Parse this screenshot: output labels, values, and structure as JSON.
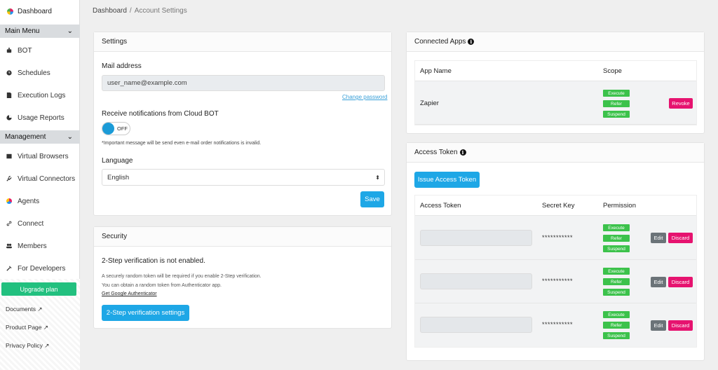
{
  "sidebar": {
    "dashboard": "Dashboard",
    "sections": [
      {
        "label": "Main Menu",
        "items": [
          "BOT",
          "Schedules",
          "Execution Logs",
          "Usage Reports"
        ]
      },
      {
        "label": "Management",
        "items": [
          "Virtual Browsers",
          "Virtual Connectors",
          "Agents",
          "Connect",
          "Members",
          "For Developers"
        ]
      }
    ],
    "upgrade": "Upgrade plan",
    "links": [
      "Documents",
      "Product Page",
      "Privacy Policy"
    ]
  },
  "breadcrumb": {
    "root": "Dashboard",
    "separator": "/",
    "current": "Account Settings"
  },
  "settings": {
    "title": "Settings",
    "mail_label": "Mail address",
    "mail_value": "user_name@example.com",
    "change_password": "Change password",
    "notify_label": "Receive notifications from Cloud BOT",
    "toggle_state": "OFF",
    "important_note": "*Important message will be send even e-mail order notifications is invalid.",
    "language_label": "Language",
    "language_value": "English",
    "save": "Save"
  },
  "security": {
    "title": "Security",
    "status": "2-Step verification is not enabled.",
    "desc1": "A securely random token will be required if you enable 2-Step verification.",
    "desc2": "You can obtain a random token from Authenticator app.",
    "ga_link": "Get Google Authenticator",
    "button": "2-Step verification settings"
  },
  "connected_apps": {
    "title": "Connected Apps",
    "headers": [
      "App Name",
      "Scope"
    ],
    "rows": [
      {
        "name": "Zapier",
        "scopes": [
          "Execute",
          "Refer",
          "Suspend"
        ],
        "action": "Revoke"
      }
    ]
  },
  "access_token": {
    "title": "Access Token",
    "issue_button": "Issue Access Token",
    "headers": [
      "Access Token",
      "Secret Key",
      "Permission"
    ],
    "rows": [
      {
        "secret": "***********",
        "scopes": [
          "Execute",
          "Refer",
          "Suspend"
        ],
        "edit": "Edit",
        "discard": "Discard"
      },
      {
        "secret": "***********",
        "scopes": [
          "Execute",
          "Refer",
          "Suspend"
        ],
        "edit": "Edit",
        "discard": "Discard"
      },
      {
        "secret": "***********",
        "scopes": [
          "Execute",
          "Refer",
          "Suspend"
        ],
        "edit": "Edit",
        "discard": "Discard"
      }
    ]
  },
  "colors": {
    "accent": "#1ea7e6",
    "green": "#3cc24b",
    "pink": "#e6136f",
    "upgrade": "#22c07f"
  }
}
